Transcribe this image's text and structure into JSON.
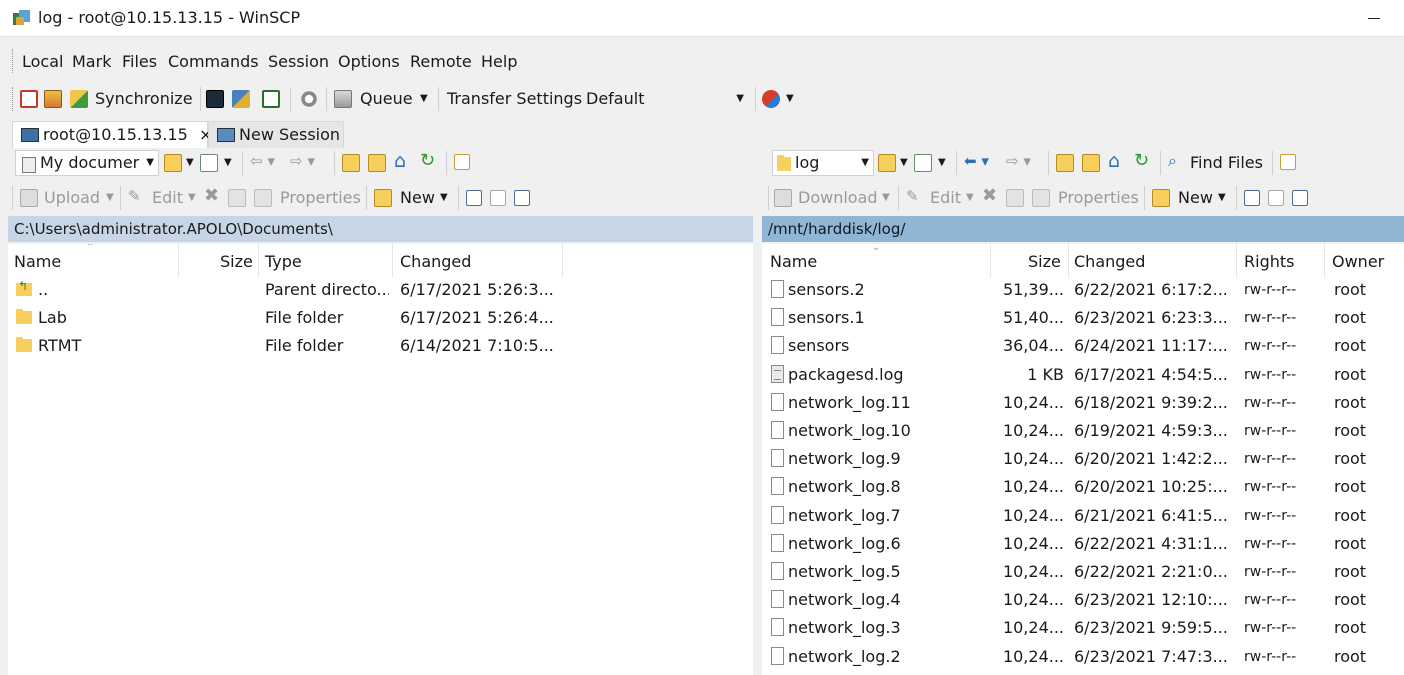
{
  "window": {
    "title": "log - root@10.15.13.15 - WinSCP"
  },
  "menu": [
    "Local",
    "Mark",
    "Files",
    "Commands",
    "Session",
    "Options",
    "Remote",
    "Help"
  ],
  "toolbar": {
    "synchronize": "Synchronize",
    "queue": "Queue",
    "transfer_settings": "Transfer Settings",
    "transfer_profile": "Default"
  },
  "tabs": [
    {
      "label": "root@10.15.13.15",
      "close": "×",
      "active": true
    },
    {
      "label": "New Session",
      "active": false
    }
  ],
  "local": {
    "location": "My documer",
    "actions": {
      "upload": "Upload",
      "edit": "Edit",
      "properties": "Properties",
      "new": "New"
    },
    "path": "C:\\Users\\administrator.APOLO\\Documents\\",
    "columns": [
      "Name",
      "Size",
      "Type",
      "Changed"
    ],
    "rows": [
      {
        "name": "..",
        "size": "",
        "type": "Parent directo...",
        "changed": "6/17/2021  5:26:3...",
        "icon": "parent-dir-icon"
      },
      {
        "name": "Lab",
        "size": "",
        "type": "File folder",
        "changed": "6/17/2021  5:26:4...",
        "icon": "folder-icon"
      },
      {
        "name": "RTMT",
        "size": "",
        "type": "File folder",
        "changed": "6/14/2021  7:10:5...",
        "icon": "folder-icon"
      }
    ]
  },
  "remote": {
    "location": "log",
    "actions": {
      "download": "Download",
      "edit": "Edit",
      "properties": "Properties",
      "new": "New",
      "find_files": "Find Files"
    },
    "path": "/mnt/harddisk/log/",
    "columns": [
      "Name",
      "Size",
      "Changed",
      "Rights",
      "Owner"
    ],
    "rows": [
      {
        "name": "sensors.2",
        "size": "51,39...",
        "changed": "6/22/2021 6:17:2...",
        "rights": "rw-r--r--",
        "owner": "root",
        "icon": "file-icon"
      },
      {
        "name": "sensors.1",
        "size": "51,40...",
        "changed": "6/23/2021 6:23:3...",
        "rights": "rw-r--r--",
        "owner": "root",
        "icon": "file-icon"
      },
      {
        "name": "sensors",
        "size": "36,04...",
        "changed": "6/24/2021 11:17:...",
        "rights": "rw-r--r--",
        "owner": "root",
        "icon": "file-icon"
      },
      {
        "name": "packagesd.log",
        "size": "1 KB",
        "changed": "6/17/2021 4:54:5...",
        "rights": "rw-r--r--",
        "owner": "root",
        "icon": "text-file-icon"
      },
      {
        "name": "network_log.11",
        "size": "10,24...",
        "changed": "6/18/2021 9:39:2...",
        "rights": "rw-r--r--",
        "owner": "root",
        "icon": "file-icon"
      },
      {
        "name": "network_log.10",
        "size": "10,24...",
        "changed": "6/19/2021 4:59:3...",
        "rights": "rw-r--r--",
        "owner": "root",
        "icon": "file-icon"
      },
      {
        "name": "network_log.9",
        "size": "10,24...",
        "changed": "6/20/2021 1:42:2...",
        "rights": "rw-r--r--",
        "owner": "root",
        "icon": "file-icon"
      },
      {
        "name": "network_log.8",
        "size": "10,24...",
        "changed": "6/20/2021 10:25:...",
        "rights": "rw-r--r--",
        "owner": "root",
        "icon": "file-icon"
      },
      {
        "name": "network_log.7",
        "size": "10,24...",
        "changed": "6/21/2021 6:41:5...",
        "rights": "rw-r--r--",
        "owner": "root",
        "icon": "file-icon"
      },
      {
        "name": "network_log.6",
        "size": "10,24...",
        "changed": "6/22/2021 4:31:1...",
        "rights": "rw-r--r--",
        "owner": "root",
        "icon": "file-icon"
      },
      {
        "name": "network_log.5",
        "size": "10,24...",
        "changed": "6/22/2021 2:21:0...",
        "rights": "rw-r--r--",
        "owner": "root",
        "icon": "file-icon"
      },
      {
        "name": "network_log.4",
        "size": "10,24...",
        "changed": "6/23/2021 12:10:...",
        "rights": "rw-r--r--",
        "owner": "root",
        "icon": "file-icon"
      },
      {
        "name": "network_log.3",
        "size": "10,24...",
        "changed": "6/23/2021 9:59:5...",
        "rights": "rw-r--r--",
        "owner": "root",
        "icon": "file-icon"
      },
      {
        "name": "network_log.2",
        "size": "10,24...",
        "changed": "6/23/2021 7:47:3...",
        "rights": "rw-r--r--",
        "owner": "root",
        "icon": "file-icon"
      }
    ]
  },
  "colors": {
    "local_path_bg": "#c6d6e6",
    "remote_path_bg": "#91b5d4",
    "folder": "#f6cf5c"
  }
}
